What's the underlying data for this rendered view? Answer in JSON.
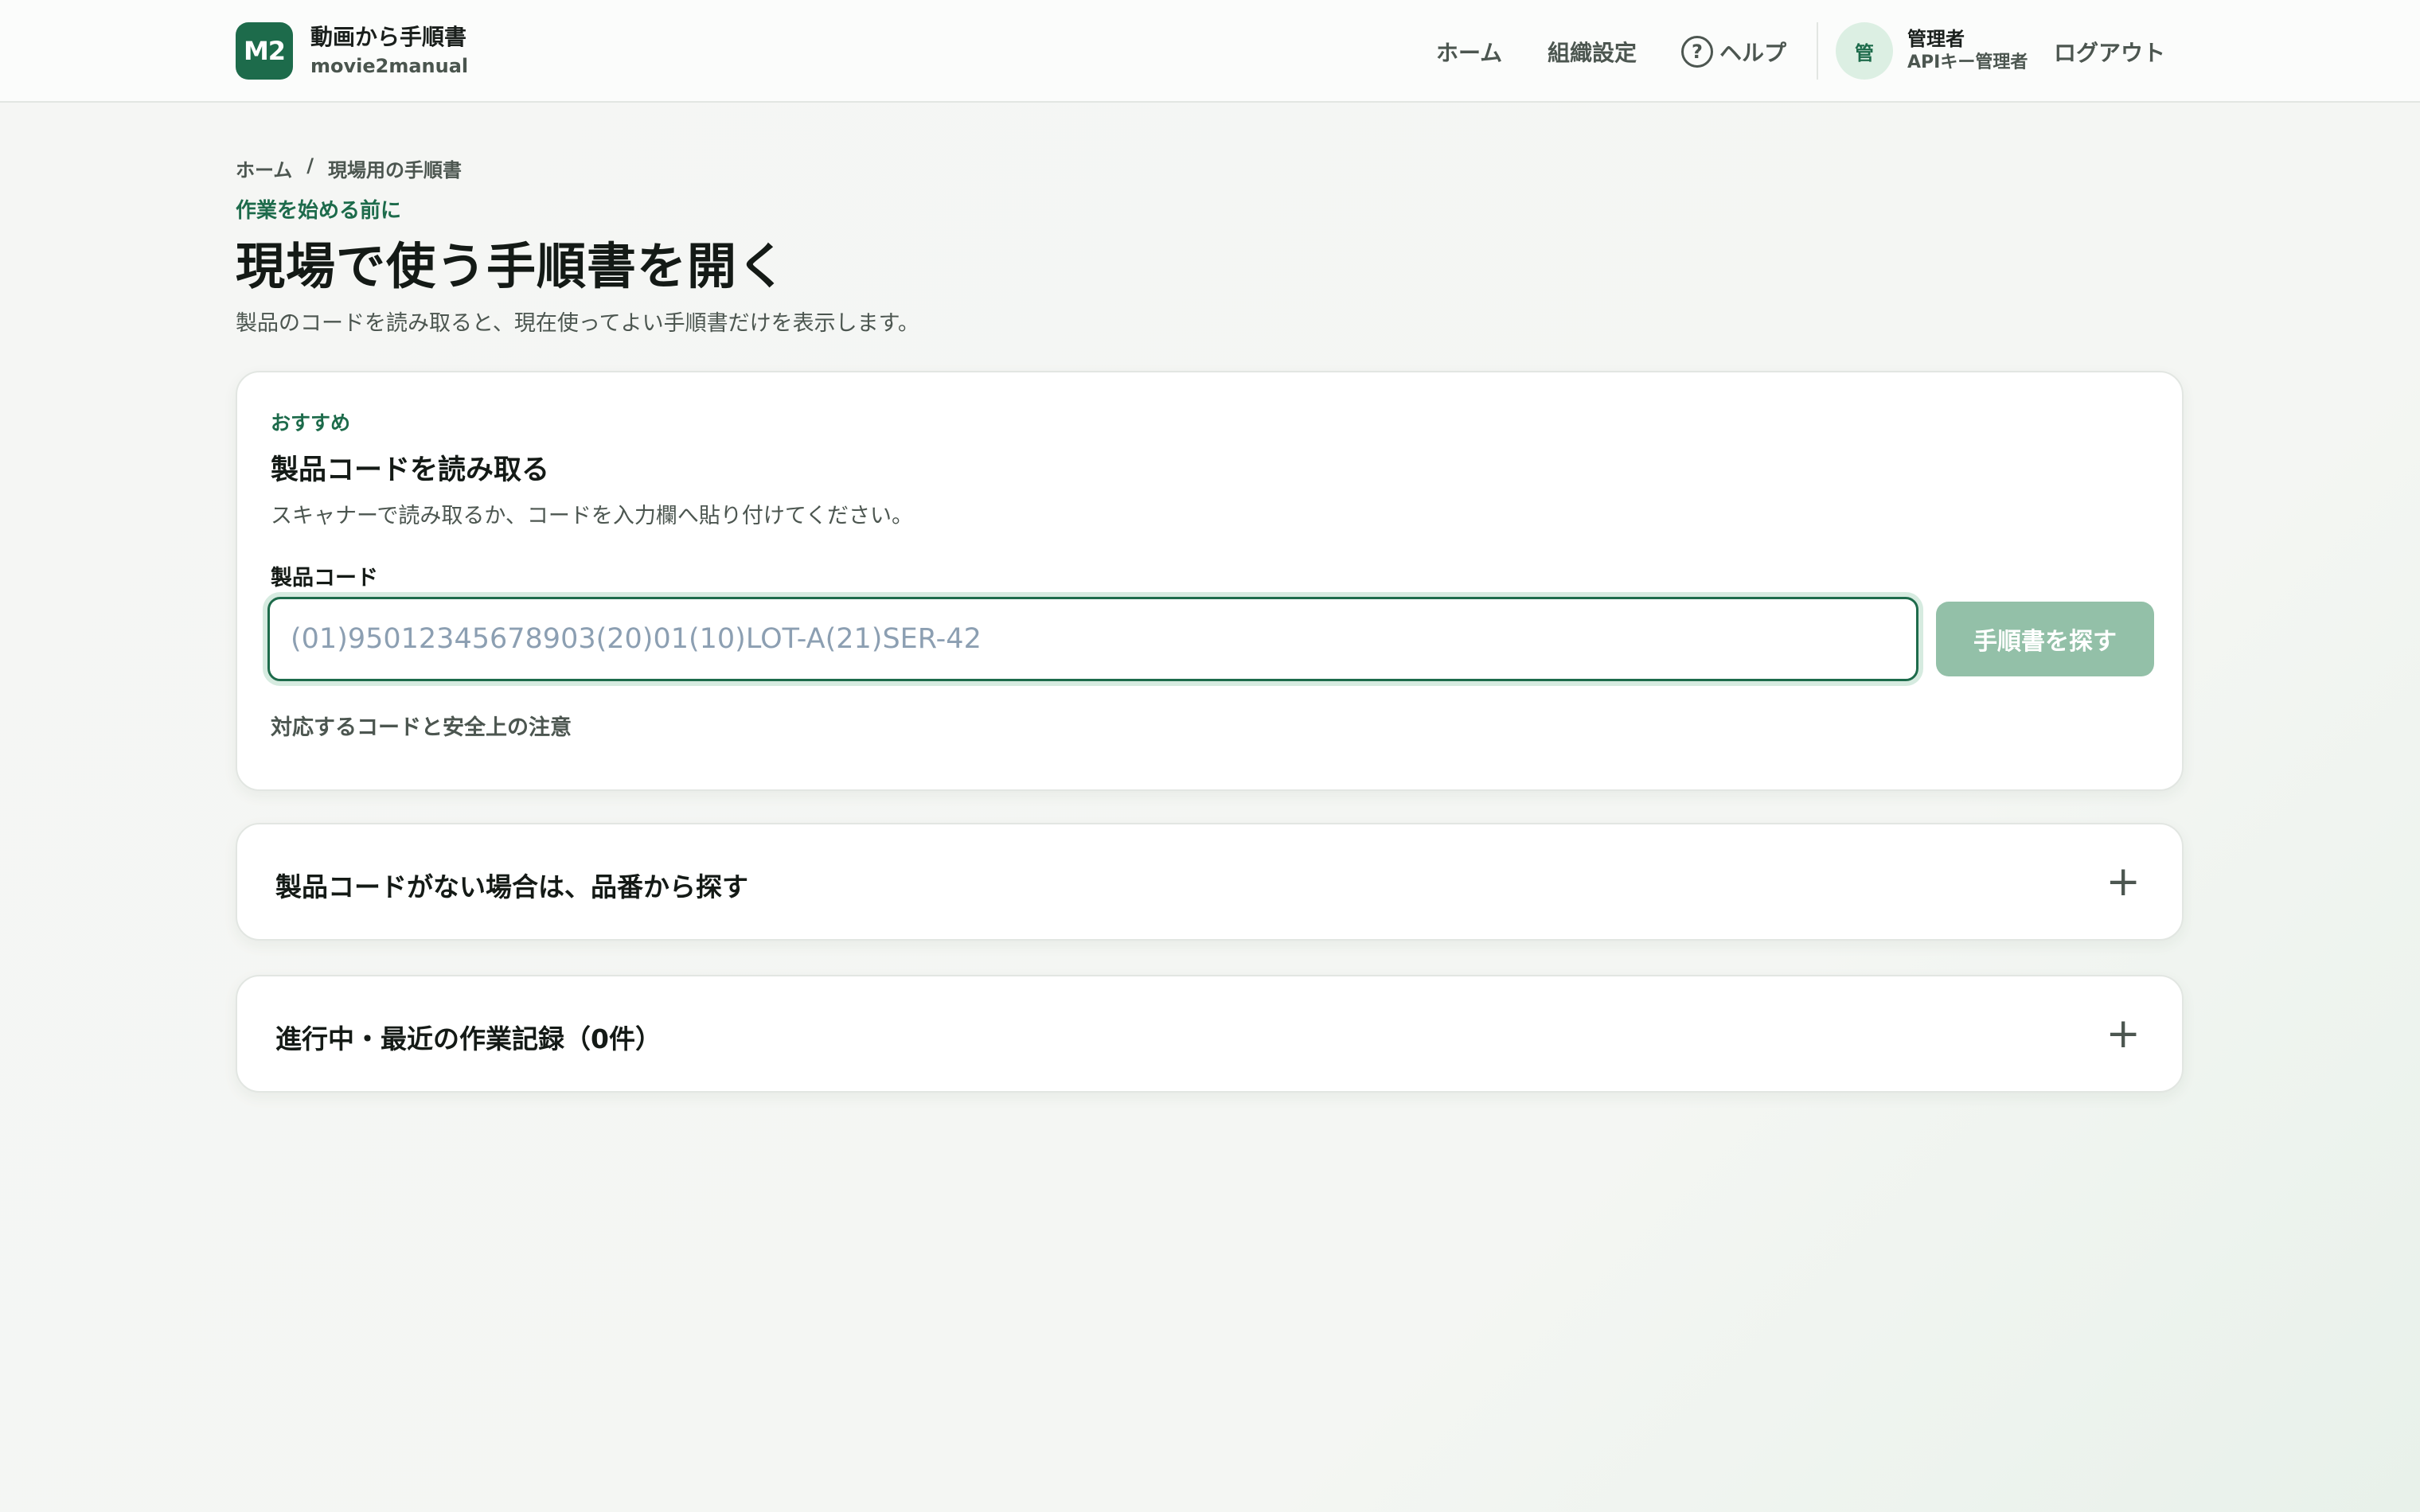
{
  "header": {
    "logo_text": "M2",
    "app_title": "動画から手順書",
    "app_subtitle": "movie2manual",
    "nav": {
      "home": "ホーム",
      "org_settings": "組織設定",
      "help_icon_glyph": "?",
      "help": "ヘルプ"
    },
    "user": {
      "avatar_initial": "管",
      "name": "管理者",
      "role": "APIキー管理者"
    },
    "logout": "ログアウト"
  },
  "breadcrumb": {
    "home": "ホーム",
    "separator": "/",
    "current": "現場用の手順書"
  },
  "page": {
    "eyebrow": "作業を始める前に",
    "title": "現場で使う手順書を開く",
    "description": "製品のコードを読み取ると、現在使ってよい手順書だけを表示します。"
  },
  "scan_card": {
    "tag": "おすすめ",
    "title": "製品コードを読み取る",
    "description": "スキャナーで読み取るか、コードを入力欄へ貼り付けてください。",
    "field_label": "製品コード",
    "input_value": "",
    "input_placeholder": "(01)95012345678903(20)01(10)LOT-A(21)SER-42",
    "search_button": "手順書を探す",
    "notes_link": "対応するコードと安全上の注意"
  },
  "accordions": [
    {
      "title": "製品コードがない場合は、品番から探す",
      "toggle": "+"
    },
    {
      "title": "進行中・最近の作業記録（0件）",
      "toggle": "+"
    }
  ],
  "colors": {
    "brand": "#1d6b4b",
    "button_disabled": "#93c0a8",
    "muted_text": "#4c5650"
  }
}
